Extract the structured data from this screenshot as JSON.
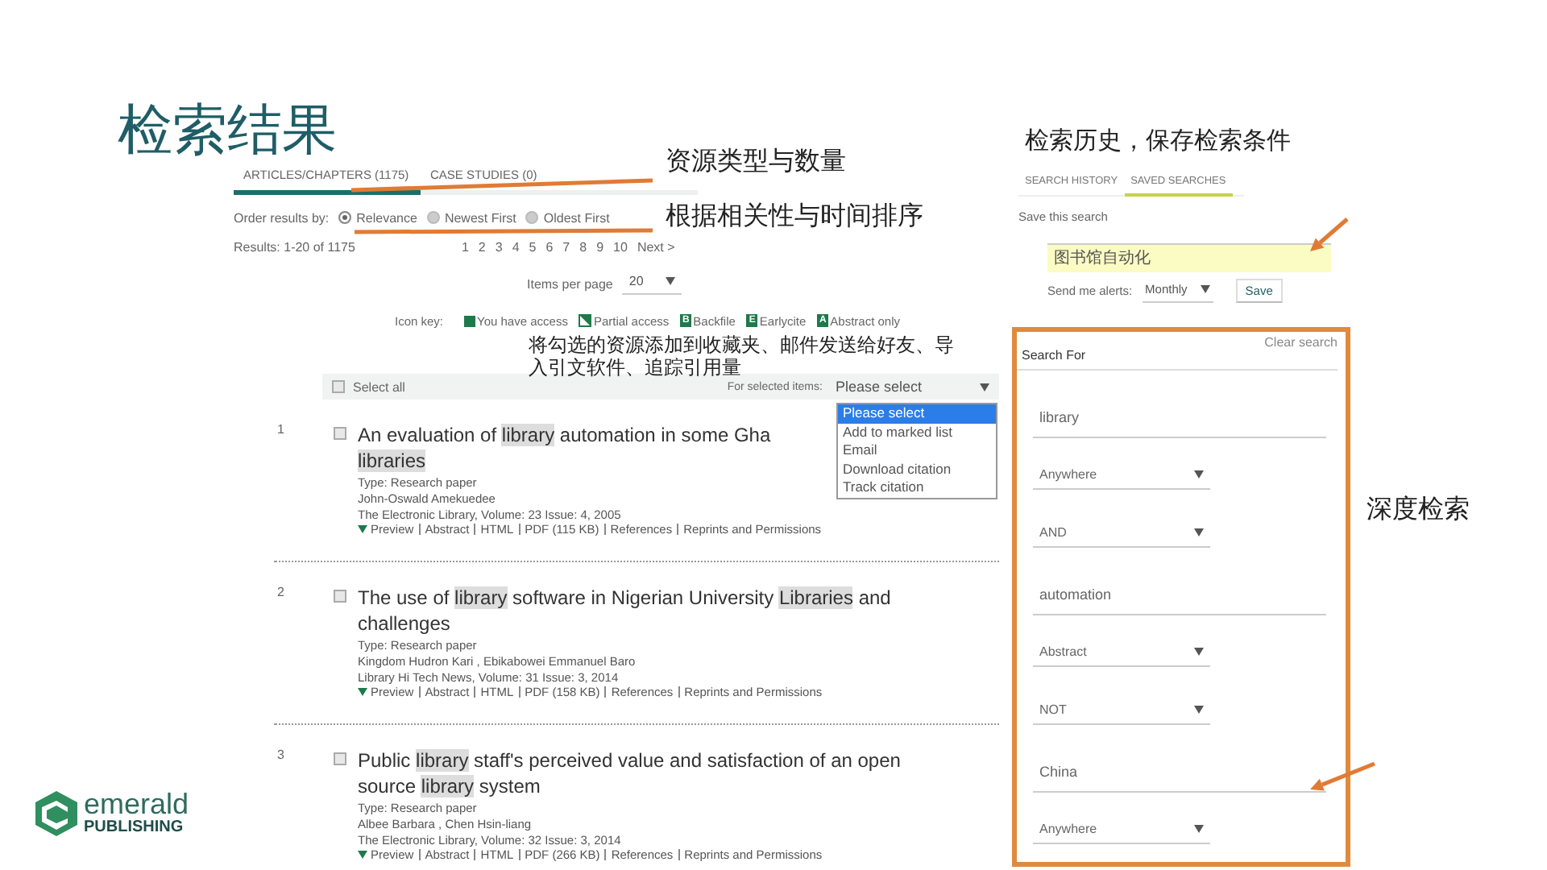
{
  "slide_title": "检索结果",
  "results_panel": {
    "tabs": [
      {
        "label": "ARTICLES/CHAPTERS (1175)",
        "selected": true
      },
      {
        "label": "CASE STUDIES (0)",
        "selected": false
      }
    ],
    "order_label": "Order results by:",
    "order_options": [
      {
        "label": "Relevance",
        "selected": true
      },
      {
        "label": "Newest First",
        "selected": false
      },
      {
        "label": "Oldest First",
        "selected": false
      }
    ],
    "results_count": "Results: 1-20 of 1175",
    "pages": [
      "1",
      "2",
      "3",
      "4",
      "5",
      "6",
      "7",
      "8",
      "9",
      "10"
    ],
    "next": "Next >",
    "per_page_label": "Items per page",
    "per_page_value": "20",
    "icon_key_label": "Icon key:",
    "icon_key": [
      {
        "kind": "full",
        "label": "You have access"
      },
      {
        "kind": "partial",
        "label": "Partial access"
      },
      {
        "kind": "letter",
        "badge": "B",
        "label": "Backfile"
      },
      {
        "kind": "letter",
        "badge": "E",
        "label": "Earlycite"
      },
      {
        "kind": "letter",
        "badge": "A",
        "label": "Abstract only"
      }
    ],
    "select_all": {
      "label": "Select all",
      "checked": false
    },
    "for_selected_label": "For selected items:",
    "action_select": {
      "value": "Please select",
      "expanded": true,
      "options": [
        {
          "label": "Please select",
          "selected": true
        },
        {
          "label": "Add to marked list",
          "selected": false
        },
        {
          "label": "Email",
          "selected": false
        },
        {
          "label": "Download citation",
          "selected": false
        },
        {
          "label": "Track citation",
          "selected": false
        }
      ]
    },
    "results": [
      {
        "number": "1",
        "checked": false,
        "title_lines": [
          [
            {
              "text": "An evaluation of ",
              "highlighted": false
            },
            {
              "text": "library",
              "highlighted": true
            },
            {
              "text": " automation in some Gha",
              "highlighted": false
            }
          ],
          [
            {
              "text": "libraries",
              "highlighted": true
            }
          ]
        ],
        "type": "Type: Research paper",
        "authors": "John-Oswald Amekuedee",
        "source": "The Electronic Library, Volume: 23 Issue: 4, 2005",
        "links": [
          "Preview",
          "Abstract",
          "HTML",
          "PDF (115 KB)",
          "References",
          "Reprints and Permissions"
        ]
      },
      {
        "number": "2",
        "checked": false,
        "title_lines": [
          [
            {
              "text": "The use of ",
              "highlighted": false
            },
            {
              "text": "library",
              "highlighted": true
            },
            {
              "text": " software in Nigerian University ",
              "highlighted": false
            },
            {
              "text": "Libraries",
              "highlighted": true
            },
            {
              "text": " and",
              "highlighted": false
            }
          ],
          [
            {
              "text": "challenges",
              "highlighted": false
            }
          ]
        ],
        "type": "Type: Research paper",
        "authors": "Kingdom Hudron Kari , Ebikabowei Emmanuel Baro",
        "source": "Library Hi Tech News, Volume: 31 Issue: 3, 2014",
        "links": [
          "Preview",
          "Abstract",
          "HTML",
          "PDF (158 KB)",
          "References",
          "Reprints and Permissions"
        ]
      },
      {
        "number": "3",
        "checked": false,
        "title_lines": [
          [
            {
              "text": "Public ",
              "highlighted": false
            },
            {
              "text": "library",
              "highlighted": true
            },
            {
              "text": " staff's perceived value and satisfaction of an open",
              "highlighted": false
            }
          ],
          [
            {
              "text": "source ",
              "highlighted": false
            },
            {
              "text": "library",
              "highlighted": true
            },
            {
              "text": " system",
              "highlighted": false
            }
          ]
        ],
        "type": "Type: Research paper",
        "authors": "Albee Barbara , Chen Hsin-liang",
        "source": "The Electronic Library, Volume: 32 Issue: 3, 2014",
        "links": [
          "Preview",
          "Abstract",
          "HTML",
          "PDF (266 KB)",
          "References",
          "Reprints and Permissions"
        ]
      }
    ]
  },
  "history_panel": {
    "tabs": [
      {
        "label": "SEARCH HISTORY",
        "selected": false
      },
      {
        "label": "SAVED SEARCHES",
        "selected": true
      }
    ],
    "save_label": "Save this search",
    "search_name": "图书馆自动化",
    "alerts_label": "Send me alerts:",
    "alerts_value": "Monthly",
    "save_button": "Save"
  },
  "search_form": {
    "heading": "Search For",
    "clear": "Clear search",
    "rows": [
      {
        "kind": "text",
        "value": "library"
      },
      {
        "kind": "select",
        "value": "Anywhere"
      },
      {
        "kind": "select",
        "value": "AND"
      },
      {
        "kind": "text",
        "value": "automation"
      },
      {
        "kind": "select",
        "value": "Abstract"
      },
      {
        "kind": "select",
        "value": "NOT"
      },
      {
        "kind": "text",
        "value": "China"
      },
      {
        "kind": "select",
        "value": "Anywhere"
      }
    ]
  },
  "annotations": [
    "资源类型与数量",
    "根据相关性与时间排序",
    "将勾选的资源添加到收藏夹、邮件发送给好友、导入引文软件、追踪引用量",
    "检索历史，保存检索条件",
    "深度检索"
  ],
  "logo": {
    "name": "emerald",
    "tagline": "PUBLISHING"
  }
}
